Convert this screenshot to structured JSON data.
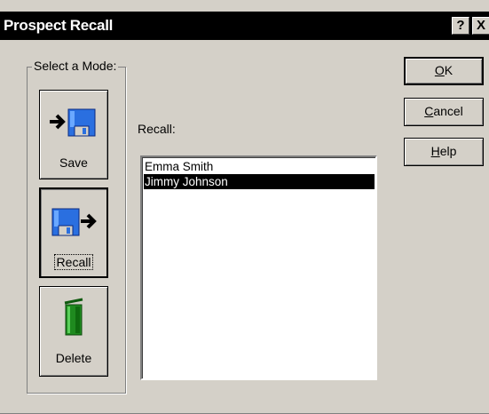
{
  "window": {
    "title": "Prospect Recall",
    "help_glyph": "?",
    "close_glyph": "X"
  },
  "mode_group": {
    "label": "Select a Mode:",
    "buttons": [
      {
        "label": "Save",
        "icon": "arrow-into-disk-icon",
        "pressed": false
      },
      {
        "label": "Recall",
        "icon": "disk-arrow-out-icon",
        "pressed": true
      },
      {
        "label": "Delete",
        "icon": "trash-can-icon",
        "pressed": false
      }
    ]
  },
  "recall": {
    "caption": "Recall:",
    "items": [
      {
        "name": "Emma Smith",
        "selected": false
      },
      {
        "name": "Jimmy Johnson",
        "selected": true
      }
    ]
  },
  "actions": {
    "ok": {
      "mnemonic": "O",
      "rest": "K"
    },
    "cancel": {
      "mnemonic": "C",
      "rest": "ancel"
    },
    "help": {
      "mnemonic": "H",
      "rest": "elp"
    }
  },
  "colors": {
    "face": "#d4d0c8",
    "titlebar": "#000000",
    "selection": "#000000",
    "disk_blue": "#2a6fe0",
    "trash_green": "#1f8a1f"
  }
}
